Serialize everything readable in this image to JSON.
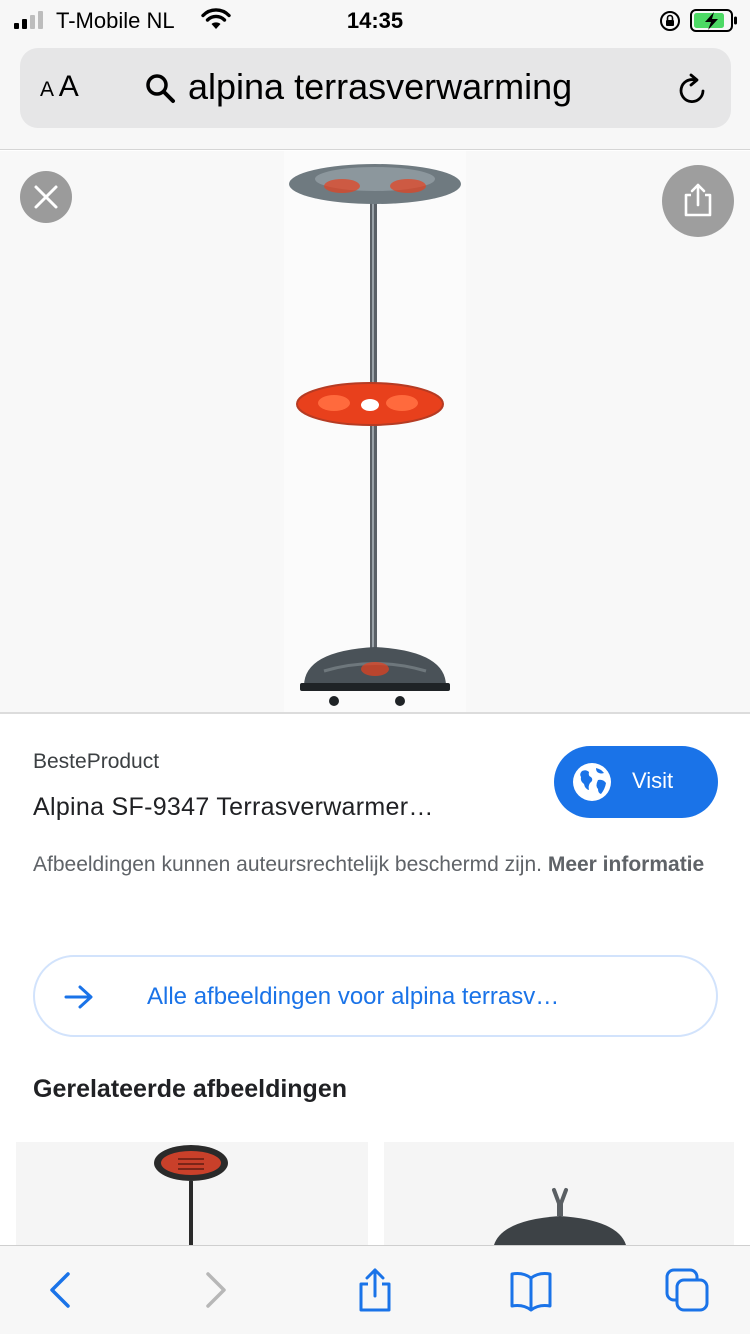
{
  "status_bar": {
    "carrier": "T-Mobile NL",
    "time": "14:35"
  },
  "address_bar": {
    "text_size_label": "AA",
    "search_query": "alpina terrasverwarming"
  },
  "result": {
    "source": "BesteProduct",
    "title": "Alpina SF-9347 Terrasverwarmer…",
    "visit_label": "Visit",
    "copyright_text": "Afbeeldingen kunnen auteursrechtelijk beschermd zijn.",
    "more_info_label": "Meer informatie",
    "all_images_label": "Alle afbeeldingen voor alpina terrasv…",
    "related_heading": "Gerelateerde afbeeldingen"
  },
  "colors": {
    "accent": "#1a73e8",
    "heater_glow": "#e8401c",
    "battery_green": "#4cd964"
  },
  "icons": {
    "signal": "signal-bars-icon",
    "wifi": "wifi-icon",
    "orientation_lock": "orientation-lock-icon",
    "battery": "battery-charging-icon",
    "search": "search-icon",
    "reload": "reload-icon",
    "close": "close-icon",
    "share": "share-icon",
    "globe": "globe-icon",
    "arrow": "arrow-right-icon",
    "back": "chevron-left-icon",
    "forward": "chevron-right-icon",
    "bookmarks": "book-icon",
    "tabs": "tabs-icon"
  }
}
